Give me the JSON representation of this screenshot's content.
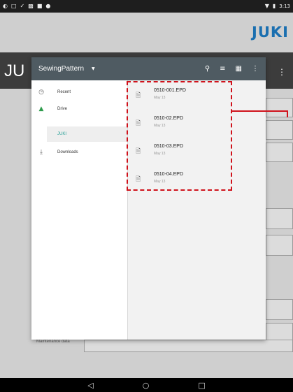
{
  "status_bar": {
    "left_icons": [
      "notification-icon",
      "download-icon",
      "check-icon",
      "image-icon",
      "box-icon",
      "bug-icon"
    ],
    "right_icons": [
      "wifi-icon",
      "battery-icon"
    ],
    "time": "3:13"
  },
  "app": {
    "brand": "JUKI",
    "title_fragment": "JU",
    "background_label": "Maintenance data"
  },
  "dialog": {
    "title": "SewingPattern",
    "toolbar_icons": [
      "search-icon",
      "sort-icon",
      "grid-view-icon",
      "more-vert-icon"
    ],
    "sidebar": [
      {
        "label": "Recent",
        "icon": "clock-icon"
      },
      {
        "label": "Drive",
        "icon": "drive-icon"
      },
      {
        "label": "JUKI",
        "icon": "",
        "active": true
      },
      {
        "label": "Downloads",
        "icon": "download-icon"
      }
    ],
    "files": [
      {
        "name": "0510-001.EPD",
        "date": "May 13"
      },
      {
        "name": "0510-02.EPD",
        "date": "May 13"
      },
      {
        "name": "0510-03.EPD",
        "date": "May 13"
      },
      {
        "name": "0510-04.EPD",
        "date": "May 13"
      }
    ]
  },
  "colors": {
    "toolbar": "#4f5b62",
    "accent": "#2aa198",
    "annotation": "#d0121b",
    "brand": "#1a6fb0"
  }
}
